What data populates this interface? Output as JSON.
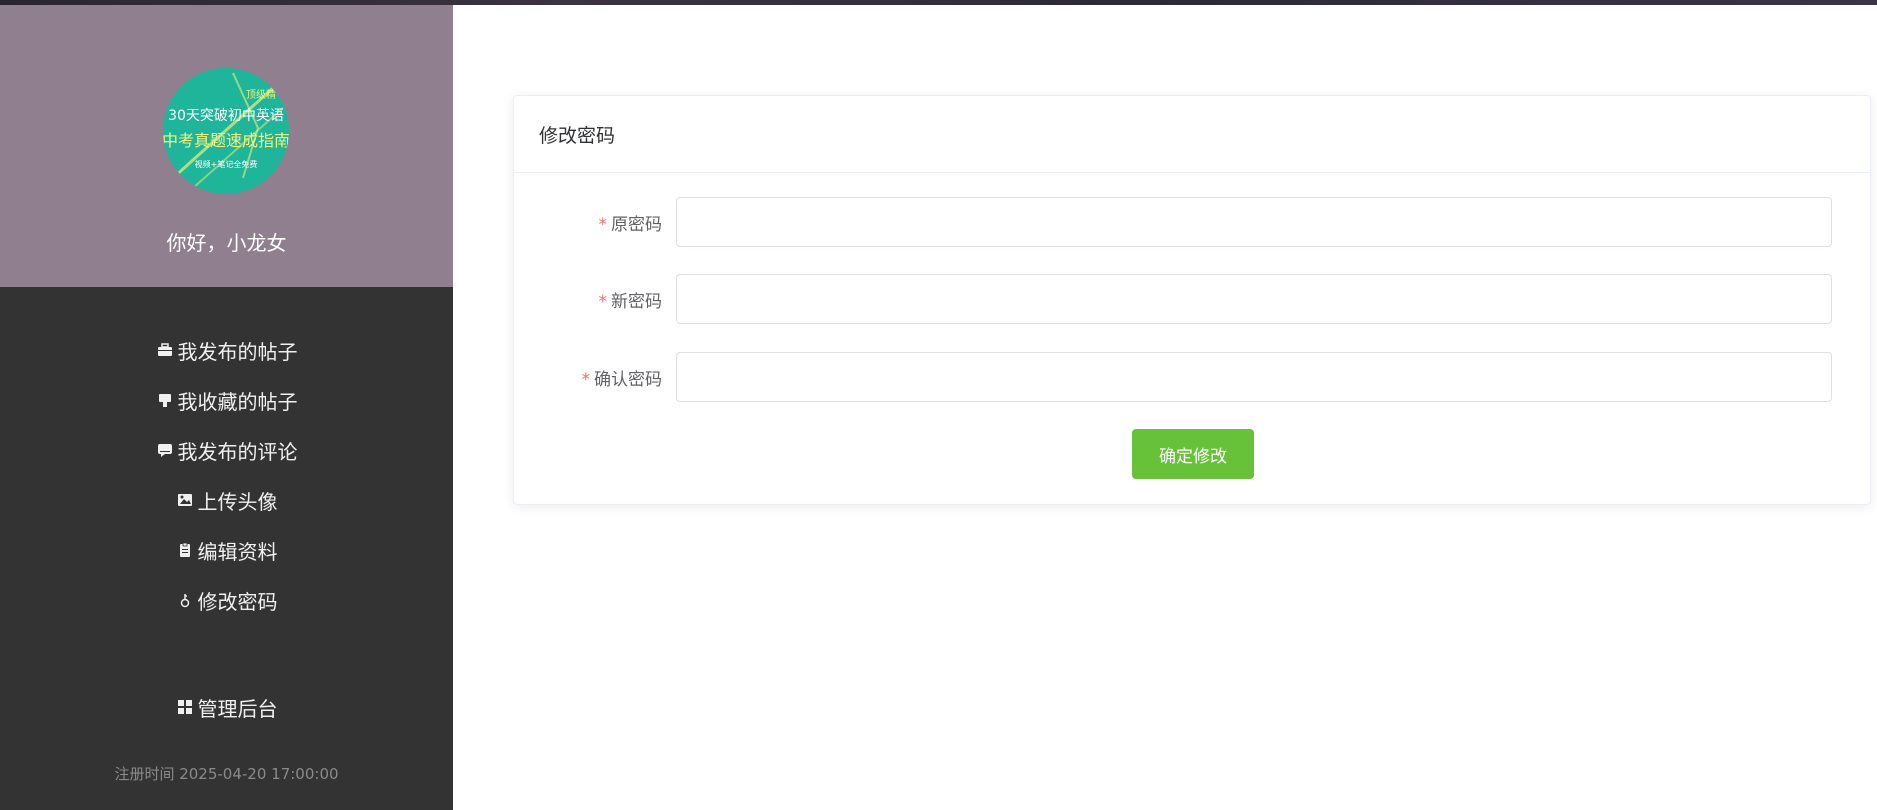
{
  "sidebar": {
    "avatar": {
      "line1": "30天突破初中英语",
      "line2": "中考真题速成指南",
      "line3": "视频+笔记全免费",
      "corner": "顶级精",
      "bg_color": "#1fb59a"
    },
    "greeting": "你好，小龙女",
    "menu": [
      {
        "label": "我发布的帖子",
        "icon": "briefcase-icon"
      },
      {
        "label": "我收藏的帖子",
        "icon": "star-icon"
      },
      {
        "label": "我发布的评论",
        "icon": "comment-icon"
      },
      {
        "label": "上传头像",
        "icon": "image-icon"
      },
      {
        "label": "编辑资料",
        "icon": "clipboard-icon"
      },
      {
        "label": "修改密码",
        "icon": "key-icon"
      }
    ],
    "admin": {
      "label": "管理后台",
      "icon": "grid-icon"
    },
    "reg_time": "注册时间 2025-04-20 17:00:00"
  },
  "form": {
    "title": "修改密码",
    "required_mark": "*",
    "fields": [
      {
        "label": "原密码",
        "value": ""
      },
      {
        "label": "新密码",
        "value": ""
      },
      {
        "label": "确认密码",
        "value": ""
      }
    ],
    "submit_label": "确定修改"
  },
  "colors": {
    "sidebar_bg": "#333333",
    "profile_bg": "#8f7f8f",
    "primary_button": "#67c23a",
    "required": "#f56c6c"
  }
}
